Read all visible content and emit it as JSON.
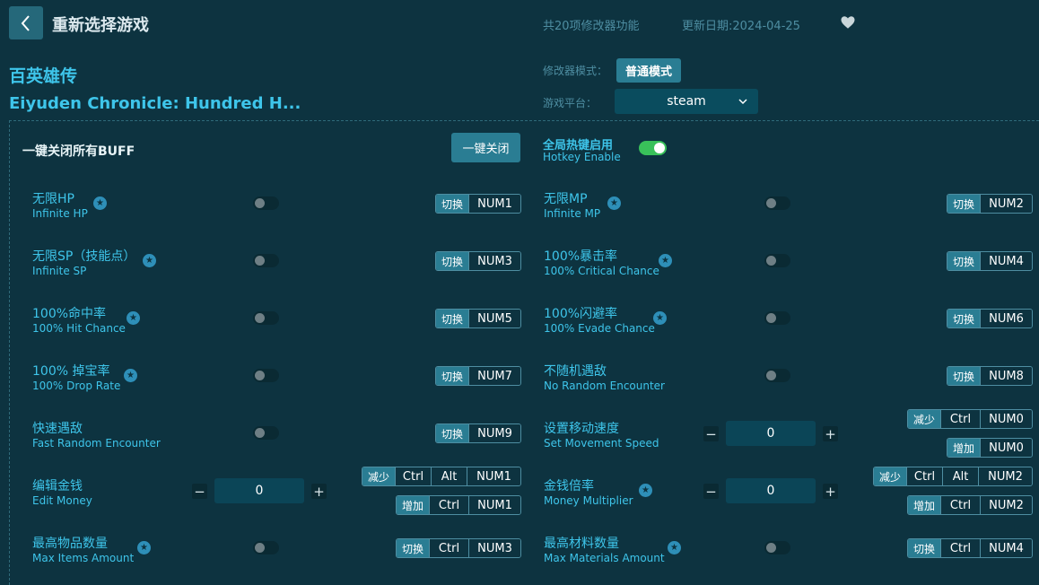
{
  "header": {
    "title": "重新选择游戏",
    "feature_count": "共20项修改器功能",
    "update_date": "更新日期:2024-04-25"
  },
  "game": {
    "name_cn": "百英雄传",
    "name_en": "Eiyuden Chronicle: Hundred H..."
  },
  "mode": {
    "label": "修改器模式：",
    "value": "普通模式"
  },
  "platform": {
    "label": "游戏平台：",
    "value": "steam"
  },
  "global": {
    "all_buff_label": "一键关闭所有BUFF",
    "close_all_button": "一键关闭",
    "hotkey_cn": "全局热键启用",
    "hotkey_en": "Hotkey Enable",
    "hotkey_enabled": true
  },
  "options": {
    "infinite_hp": {
      "cn": "无限HP",
      "en": "Infinite HP",
      "tag": "切换",
      "key1": "NUM1"
    },
    "infinite_mp": {
      "cn": "无限MP",
      "en": "Infinite MP",
      "tag": "切换",
      "key1": "NUM2"
    },
    "infinite_sp": {
      "cn": "无限SP（技能点）",
      "en": "Infinite SP",
      "tag": "切换",
      "key1": "NUM3"
    },
    "crit": {
      "cn": "100%暴击率",
      "en": "100% Critical Chance",
      "tag": "切换",
      "key1": "NUM4"
    },
    "hit": {
      "cn": "100%命中率",
      "en": "100% Hit Chance",
      "tag": "切换",
      "key1": "NUM5"
    },
    "evade": {
      "cn": "100%闪避率",
      "en": "100% Evade Chance",
      "tag": "切换",
      "key1": "NUM6"
    },
    "drop": {
      "cn": "100% 掉宝率",
      "en": "100% Drop Rate",
      "tag": "切换",
      "key1": "NUM7"
    },
    "no_random": {
      "cn": "不随机遇敌",
      "en": "No Random Encounter",
      "tag": "切换",
      "key1": "NUM8"
    },
    "fast_random": {
      "cn": "快速遇敌",
      "en": "Fast Random Encounter",
      "tag": "切换",
      "key1": "NUM9"
    },
    "move_speed": {
      "cn": "设置移动速度",
      "en": "Set Movement Speed",
      "value": "0",
      "dec_tag": "减少",
      "dec_k1": "Ctrl",
      "dec_k2": "NUM0",
      "inc_tag": "增加",
      "inc_k1": "NUM0"
    },
    "edit_money": {
      "cn": "编辑金钱",
      "en": "Edit Money",
      "value": "0",
      "dec_tag": "减少",
      "dec_k1": "Ctrl",
      "dec_k2": "Alt",
      "dec_k3": "NUM1",
      "inc_tag": "增加",
      "inc_k1": "Ctrl",
      "inc_k2": "NUM1"
    },
    "money_mult": {
      "cn": "金钱倍率",
      "en": "Money Multiplier",
      "value": "0",
      "dec_tag": "减少",
      "dec_k1": "Ctrl",
      "dec_k2": "Alt",
      "dec_k3": "NUM2",
      "inc_tag": "增加",
      "inc_k1": "Ctrl",
      "inc_k2": "NUM2"
    },
    "max_items": {
      "cn": "最高物品数量",
      "en": "Max Items Amount",
      "tag": "切换",
      "key1": "Ctrl",
      "key2": "NUM3"
    },
    "max_materials": {
      "cn": "最高材料数量",
      "en": "Max Materials Amount",
      "tag": "切换",
      "key1": "Ctrl",
      "key2": "NUM4"
    }
  },
  "icons": {
    "back": "chevron-left-icon",
    "favorite": "heart-icon",
    "star": "star-icon",
    "dropdown": "chevron-down-icon"
  },
  "colors": {
    "background": "#0d3340",
    "accent": "#3ec5ea",
    "button": "#2a7d93",
    "toggle_on": "#39c15a"
  }
}
